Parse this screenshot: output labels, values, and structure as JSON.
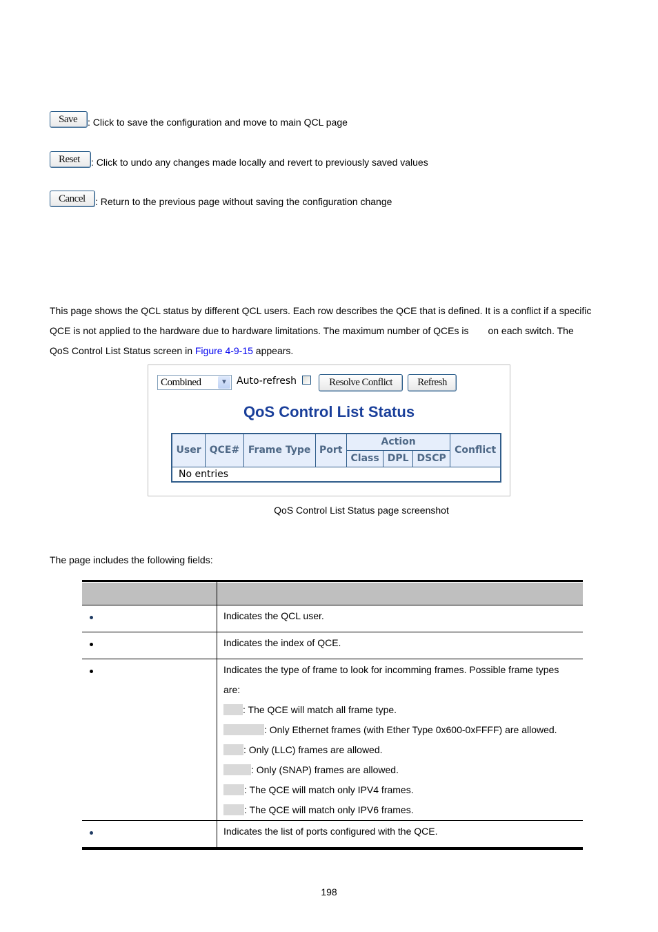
{
  "buttons_help": [
    {
      "button_label": "Save",
      "description": ": Click to save the configuration and move to main QCL page"
    },
    {
      "button_label": "Reset",
      "description": ": Click to undo any changes made locally and revert to previously saved values"
    },
    {
      "button_label": "Cancel",
      "description": ": Return to the previous page without saving the configuration change"
    }
  ],
  "intro": {
    "line1": "This page shows the QCL status by different QCL users. Each row describes the QCE that is defined. It is a conflict if a specific",
    "line2a": "QCE is not applied to the hardware due to hardware limitations. The maximum number of QCEs is",
    "line2b": "on each switch. The",
    "line3a": "QoS Control List Status screen in ",
    "line3_link": "Figure 4-9-15",
    "line3b": " appears."
  },
  "screenshot": {
    "user_select_value": "Combined",
    "auto_refresh_label": "Auto-refresh",
    "auto_refresh_checked": false,
    "resolve_conflict_label": "Resolve Conflict",
    "refresh_label": "Refresh",
    "title": "QoS Control List Status",
    "table": {
      "headers": [
        "User",
        "QCE#",
        "Frame Type",
        "Port",
        "Action",
        "Conflict"
      ],
      "action_subheaders": [
        "Class",
        "DPL",
        "DSCP"
      ],
      "empty_text": "No entries"
    }
  },
  "caption": "QoS Control List Status page screenshot",
  "fields_intro": "The page includes the following fields:",
  "fields_table": {
    "header": [
      "",
      ""
    ],
    "rows": [
      {
        "object": "",
        "description": [
          "Indicates the QCL user."
        ]
      },
      {
        "object": "",
        "description": [
          "Indicates the index of QCE."
        ]
      },
      {
        "object": "",
        "description": [
          "Indicates the type of frame to look for incomming frames. Possible frame types",
          "are:",
          ": The QCE will match all frame type.",
          ": Only Ethernet frames (with Ether Type 0x600-0xFFFF) are allowed.",
          ": Only (LLC) frames are allowed.",
          ": Only (SNAP) frames are allowed.",
          ": The QCE will match only IPV4 frames.",
          ": The QCE will match only IPV6 frames."
        ]
      },
      {
        "object": "",
        "description": [
          "Indicates the list of ports configured with the QCE."
        ]
      }
    ]
  },
  "page_number": "198"
}
